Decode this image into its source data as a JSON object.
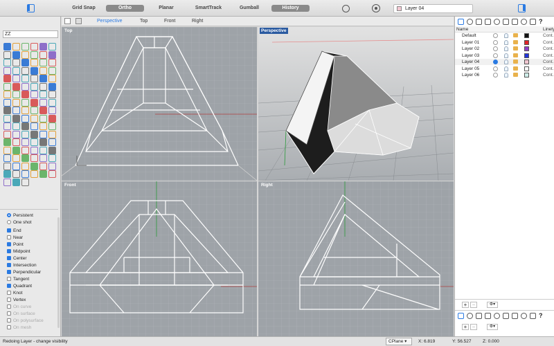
{
  "toolbar": {
    "grid_snap": "Grid Snap",
    "ortho": "Ortho",
    "planar": "Planar",
    "smarttrack": "SmartTrack",
    "gumball": "Gumball",
    "history": "History",
    "current_layer": "Layer 04"
  },
  "command": {
    "value": "ZZ"
  },
  "viewport_tabs": [
    "Perspective",
    "Top",
    "Front",
    "Right"
  ],
  "viewports": {
    "top": "Top",
    "perspective": "Perspective",
    "front": "Front",
    "right": "Right"
  },
  "osnap": {
    "persistent": "Persistent",
    "one_shot": "One shot",
    "items": [
      {
        "label": "End",
        "checked": true
      },
      {
        "label": "Near",
        "checked": false
      },
      {
        "label": "Point",
        "checked": true
      },
      {
        "label": "Midpoint",
        "checked": true
      },
      {
        "label": "Center",
        "checked": true
      },
      {
        "label": "Intersection",
        "checked": true
      },
      {
        "label": "Perpendicular",
        "checked": true
      },
      {
        "label": "Tangent",
        "checked": false
      },
      {
        "label": "Quadrant",
        "checked": true
      },
      {
        "label": "Knot",
        "checked": false
      },
      {
        "label": "Vertex",
        "checked": false
      },
      {
        "label": "On curve",
        "checked": false
      },
      {
        "label": "On surface",
        "checked": false
      },
      {
        "label": "On polysurface",
        "checked": false
      },
      {
        "label": "On mesh",
        "checked": false
      }
    ]
  },
  "layers": {
    "col_name": "Name",
    "col_linetype": "Linety",
    "rows": [
      {
        "name": "Default",
        "color": "#111111",
        "linetype": "Cont.",
        "current": false
      },
      {
        "name": "Layer 01",
        "color": "#e0262b",
        "linetype": "Cont.",
        "current": false
      },
      {
        "name": "Layer 02",
        "color": "#8e3fc9",
        "linetype": "Cont.",
        "current": false
      },
      {
        "name": "Layer 03",
        "color": "#2236d8",
        "linetype": "Cont.",
        "current": false
      },
      {
        "name": "Layer 04",
        "color": "#f1c6d0",
        "linetype": "Cont.",
        "current": true
      },
      {
        "name": "Layer 05",
        "color": "#ffffff",
        "linetype": "Cont.",
        "current": false
      },
      {
        "name": "Layer 06",
        "color": "#cfeeea",
        "linetype": "Cont.",
        "current": false
      }
    ]
  },
  "status": {
    "message": "Redoing Layer - change visibility",
    "cplane": "CPlane",
    "x": "X: 6.819",
    "y": "Y: 56.527",
    "z": "Z: 0.000"
  }
}
